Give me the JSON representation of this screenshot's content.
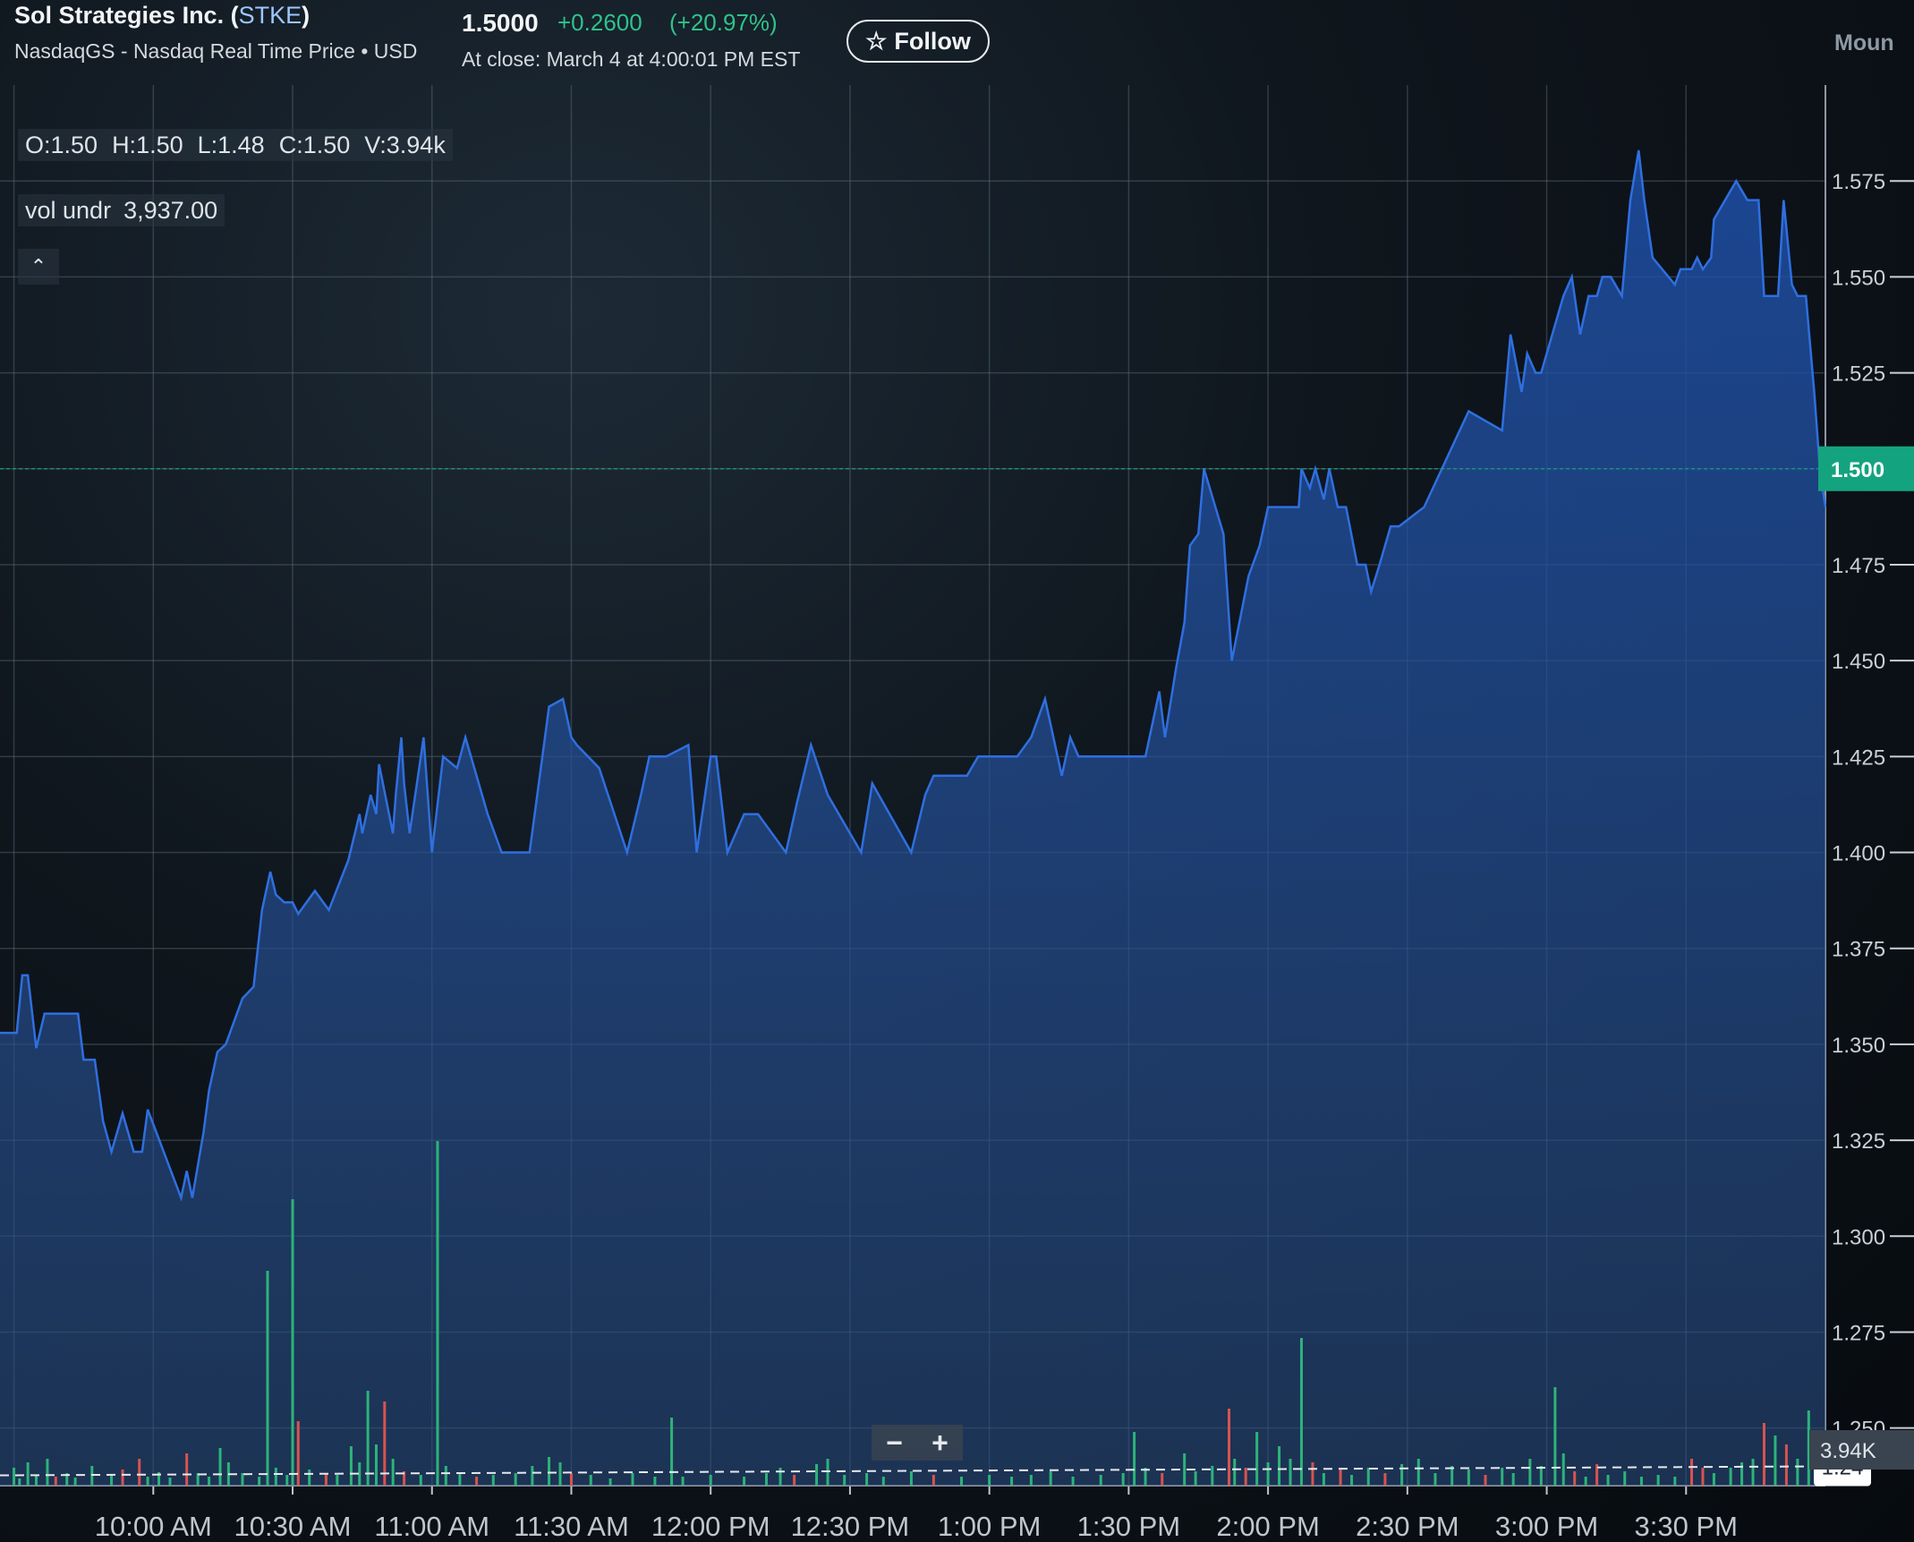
{
  "header": {
    "company_name": "Sol Strategies Inc. (",
    "ticker": "STKE",
    "company_close": ")",
    "exchange": "NasdaqGS - Nasdaq Real Time Price • USD",
    "price": "1.5000",
    "change": "+0.2600",
    "change_pct": "(+20.97%)",
    "close_time": "At close: March 4 at 4:00:01 PM EST",
    "follow_label": "Follow",
    "more_label": "Moun"
  },
  "ohlc": {
    "o": "O:1.50",
    "h": "H:1.50",
    "l": "L:1.48",
    "c": "C:1.50",
    "v": "V:3.94k"
  },
  "volume_info": {
    "label": "vol undr",
    "value": "3,937.00"
  },
  "zoom": {
    "minus": "−",
    "plus": "+"
  },
  "colors": {
    "line": "#2f6fe0",
    "up": "#2db37a",
    "down": "#d9534f",
    "current": "#14a37f"
  },
  "chart_data": {
    "type": "area",
    "title": "",
    "xlabel": "",
    "ylabel": "",
    "ylim": [
      1.235,
      1.6
    ],
    "y_ticks": [
      "1.575",
      "1.550",
      "1.525",
      "1.500",
      "1.475",
      "1.450",
      "1.425",
      "1.400",
      "1.375",
      "1.350",
      "1.325",
      "1.300",
      "1.275",
      "1.250"
    ],
    "x_ticks": [
      {
        "t": 10.0,
        "label": "10:00 AM"
      },
      {
        "t": 10.5,
        "label": "10:30 AM"
      },
      {
        "t": 11.0,
        "label": "11:00 AM"
      },
      {
        "t": 11.5,
        "label": "11:30 AM"
      },
      {
        "t": 12.0,
        "label": "12:00 PM"
      },
      {
        "t": 12.5,
        "label": "12:30 PM"
      },
      {
        "t": 13.0,
        "label": "1:00 PM"
      },
      {
        "t": 13.5,
        "label": "1:30 PM"
      },
      {
        "t": 14.0,
        "label": "2:00 PM"
      },
      {
        "t": 14.5,
        "label": "2:30 PM"
      },
      {
        "t": 15.0,
        "label": "3:00 PM"
      },
      {
        "t": 15.5,
        "label": "3:30 PM"
      }
    ],
    "x_range": [
      9.45,
      16.0
    ],
    "current_price": {
      "value": 1.5,
      "label": "1.500"
    },
    "prev_close": {
      "value": 1.24,
      "label": "1.24"
    },
    "volume_label": "3.94K",
    "grid": true,
    "price_series": {
      "x": [
        9.45,
        9.51,
        9.53,
        9.55,
        9.58,
        9.61,
        9.73,
        9.75,
        9.79,
        9.82,
        9.85,
        9.89,
        9.93,
        9.96,
        9.98,
        10.1,
        10.12,
        10.14,
        10.18,
        10.2,
        10.23,
        10.26,
        10.32,
        10.36,
        10.39,
        10.42,
        10.44,
        10.47,
        10.5,
        10.52,
        10.58,
        10.63,
        10.7,
        10.74,
        10.75,
        10.78,
        10.8,
        10.81,
        10.86,
        10.87,
        10.89,
        10.9,
        10.92,
        10.93,
        10.95,
        10.97,
        11.0,
        11.04,
        11.09,
        11.12,
        11.2,
        11.25,
        11.3,
        11.35,
        11.42,
        11.47,
        11.5,
        11.52,
        11.6,
        11.7,
        11.75,
        11.78,
        11.84,
        11.92,
        11.95,
        12.0,
        12.02,
        12.06,
        12.12,
        12.17,
        12.27,
        12.31,
        12.36,
        12.42,
        12.46,
        12.54,
        12.58,
        12.72,
        12.77,
        12.8,
        12.88,
        12.92,
        12.96,
        13.0,
        13.01,
        13.1,
        13.15,
        13.2,
        13.26,
        13.29,
        13.32,
        13.36,
        13.43,
        13.52,
        13.56,
        13.61,
        13.63,
        13.67,
        13.7,
        13.72,
        13.75,
        13.77,
        13.84,
        13.87,
        13.93,
        13.97,
        14.0,
        14.06,
        14.11,
        14.12,
        14.15,
        14.17,
        14.2,
        14.22,
        14.25,
        14.28,
        14.32,
        14.35,
        14.37,
        14.4,
        14.44,
        14.47,
        14.56,
        14.72,
        14.84,
        14.87,
        14.91,
        14.93,
        14.96,
        14.98,
        15.06,
        15.09,
        15.12,
        15.15,
        15.18,
        15.2,
        15.23,
        15.27,
        15.3,
        15.33,
        15.35,
        15.38,
        15.46,
        15.48,
        15.52,
        15.54,
        15.56,
        15.59,
        15.6,
        15.68,
        15.72,
        15.76,
        15.78,
        15.8,
        15.83,
        15.85,
        15.88,
        15.9,
        15.93,
        15.96,
        15.98,
        16.0
      ],
      "y": [
        1.353,
        1.353,
        1.368,
        1.368,
        1.349,
        1.358,
        1.358,
        1.346,
        1.346,
        1.33,
        1.322,
        1.332,
        1.322,
        1.322,
        1.333,
        1.31,
        1.317,
        1.31,
        1.327,
        1.338,
        1.348,
        1.35,
        1.362,
        1.365,
        1.385,
        1.395,
        1.389,
        1.387,
        1.387,
        1.384,
        1.39,
        1.385,
        1.398,
        1.41,
        1.405,
        1.415,
        1.41,
        1.423,
        1.405,
        1.415,
        1.43,
        1.418,
        1.405,
        1.41,
        1.42,
        1.43,
        1.4,
        1.425,
        1.422,
        1.43,
        1.41,
        1.4,
        1.4,
        1.4,
        1.438,
        1.44,
        1.43,
        1.428,
        1.422,
        1.4,
        1.415,
        1.425,
        1.425,
        1.428,
        1.4,
        1.425,
        1.425,
        1.4,
        1.41,
        1.41,
        1.4,
        1.413,
        1.428,
        1.415,
        1.41,
        1.4,
        1.418,
        1.4,
        1.415,
        1.42,
        1.42,
        1.42,
        1.425,
        1.425,
        1.425,
        1.425,
        1.43,
        1.44,
        1.42,
        1.43,
        1.425,
        1.425,
        1.425,
        1.425,
        1.425,
        1.442,
        1.43,
        1.448,
        1.46,
        1.48,
        1.483,
        1.5,
        1.483,
        1.45,
        1.472,
        1.48,
        1.49,
        1.49,
        1.49,
        1.5,
        1.495,
        1.5,
        1.492,
        1.5,
        1.49,
        1.49,
        1.475,
        1.475,
        1.468,
        1.475,
        1.485,
        1.485,
        1.49,
        1.515,
        1.51,
        1.535,
        1.52,
        1.53,
        1.525,
        1.525,
        1.545,
        1.55,
        1.535,
        1.545,
        1.545,
        1.55,
        1.55,
        1.545,
        1.57,
        1.583,
        1.57,
        1.555,
        1.548,
        1.552,
        1.552,
        1.555,
        1.552,
        1.555,
        1.565,
        1.575,
        1.57,
        1.57,
        1.545,
        1.545,
        1.545,
        1.57,
        1.548,
        1.545,
        1.545,
        1.52,
        1.5,
        1.49,
        1.49,
        1.5
      ]
    },
    "volume_bars": [
      {
        "t": 9.5,
        "h": 20,
        "d": "up"
      },
      {
        "t": 9.52,
        "h": 8,
        "d": "up"
      },
      {
        "t": 9.55,
        "h": 26,
        "d": "up"
      },
      {
        "t": 9.58,
        "h": 12,
        "d": "up"
      },
      {
        "t": 9.62,
        "h": 30,
        "d": "up"
      },
      {
        "t": 9.65,
        "h": 10,
        "d": "down"
      },
      {
        "t": 9.69,
        "h": 14,
        "d": "up"
      },
      {
        "t": 9.72,
        "h": 9,
        "d": "up"
      },
      {
        "t": 9.78,
        "h": 22,
        "d": "up"
      },
      {
        "t": 9.85,
        "h": 12,
        "d": "up"
      },
      {
        "t": 9.89,
        "h": 18,
        "d": "down"
      },
      {
        "t": 9.95,
        "h": 30,
        "d": "down"
      },
      {
        "t": 9.98,
        "h": 10,
        "d": "up"
      },
      {
        "t": 10.02,
        "h": 15,
        "d": "up"
      },
      {
        "t": 10.06,
        "h": 9,
        "d": "up"
      },
      {
        "t": 10.12,
        "h": 36,
        "d": "down"
      },
      {
        "t": 10.16,
        "h": 14,
        "d": "up"
      },
      {
        "t": 10.2,
        "h": 10,
        "d": "up"
      },
      {
        "t": 10.24,
        "h": 42,
        "d": "up"
      },
      {
        "t": 10.27,
        "h": 26,
        "d": "up"
      },
      {
        "t": 10.32,
        "h": 14,
        "d": "up"
      },
      {
        "t": 10.38,
        "h": 10,
        "d": "up"
      },
      {
        "t": 10.41,
        "h": 240,
        "d": "up"
      },
      {
        "t": 10.44,
        "h": 20,
        "d": "up"
      },
      {
        "t": 10.48,
        "h": 12,
        "d": "up"
      },
      {
        "t": 10.5,
        "h": 320,
        "d": "up"
      },
      {
        "t": 10.52,
        "h": 72,
        "d": "down"
      },
      {
        "t": 10.56,
        "h": 18,
        "d": "up"
      },
      {
        "t": 10.62,
        "h": 14,
        "d": "down"
      },
      {
        "t": 10.66,
        "h": 12,
        "d": "up"
      },
      {
        "t": 10.71,
        "h": 44,
        "d": "up"
      },
      {
        "t": 10.74,
        "h": 26,
        "d": "up"
      },
      {
        "t": 10.77,
        "h": 106,
        "d": "up"
      },
      {
        "t": 10.8,
        "h": 46,
        "d": "up"
      },
      {
        "t": 10.83,
        "h": 94,
        "d": "down"
      },
      {
        "t": 10.86,
        "h": 30,
        "d": "up"
      },
      {
        "t": 10.9,
        "h": 16,
        "d": "down"
      },
      {
        "t": 10.96,
        "h": 12,
        "d": "up"
      },
      {
        "t": 11.02,
        "h": 385,
        "d": "up"
      },
      {
        "t": 11.05,
        "h": 22,
        "d": "up"
      },
      {
        "t": 11.1,
        "h": 14,
        "d": "up"
      },
      {
        "t": 11.16,
        "h": 10,
        "d": "down"
      },
      {
        "t": 11.22,
        "h": 12,
        "d": "up"
      },
      {
        "t": 11.3,
        "h": 14,
        "d": "up"
      },
      {
        "t": 11.36,
        "h": 22,
        "d": "up"
      },
      {
        "t": 11.42,
        "h": 32,
        "d": "up"
      },
      {
        "t": 11.46,
        "h": 26,
        "d": "up"
      },
      {
        "t": 11.5,
        "h": 14,
        "d": "down"
      },
      {
        "t": 11.57,
        "h": 12,
        "d": "up"
      },
      {
        "t": 11.64,
        "h": 8,
        "d": "up"
      },
      {
        "t": 11.72,
        "h": 14,
        "d": "up"
      },
      {
        "t": 11.8,
        "h": 10,
        "d": "up"
      },
      {
        "t": 11.86,
        "h": 76,
        "d": "up"
      },
      {
        "t": 11.9,
        "h": 10,
        "d": "up"
      },
      {
        "t": 12.0,
        "h": 12,
        "d": "up"
      },
      {
        "t": 12.12,
        "h": 10,
        "d": "up"
      },
      {
        "t": 12.2,
        "h": 14,
        "d": "up"
      },
      {
        "t": 12.25,
        "h": 20,
        "d": "up"
      },
      {
        "t": 12.3,
        "h": 12,
        "d": "down"
      },
      {
        "t": 12.38,
        "h": 24,
        "d": "up"
      },
      {
        "t": 12.42,
        "h": 30,
        "d": "up"
      },
      {
        "t": 12.48,
        "h": 12,
        "d": "up"
      },
      {
        "t": 12.56,
        "h": 14,
        "d": "up"
      },
      {
        "t": 12.62,
        "h": 10,
        "d": "up"
      },
      {
        "t": 12.72,
        "h": 16,
        "d": "up"
      },
      {
        "t": 12.8,
        "h": 12,
        "d": "down"
      },
      {
        "t": 12.9,
        "h": 10,
        "d": "up"
      },
      {
        "t": 13.0,
        "h": 12,
        "d": "up"
      },
      {
        "t": 13.08,
        "h": 10,
        "d": "up"
      },
      {
        "t": 13.15,
        "h": 12,
        "d": "up"
      },
      {
        "t": 13.22,
        "h": 16,
        "d": "up"
      },
      {
        "t": 13.3,
        "h": 10,
        "d": "up"
      },
      {
        "t": 13.4,
        "h": 12,
        "d": "up"
      },
      {
        "t": 13.48,
        "h": 14,
        "d": "up"
      },
      {
        "t": 13.52,
        "h": 60,
        "d": "up"
      },
      {
        "t": 13.56,
        "h": 20,
        "d": "up"
      },
      {
        "t": 13.62,
        "h": 14,
        "d": "down"
      },
      {
        "t": 13.7,
        "h": 36,
        "d": "up"
      },
      {
        "t": 13.74,
        "h": 16,
        "d": "up"
      },
      {
        "t": 13.8,
        "h": 22,
        "d": "up"
      },
      {
        "t": 13.86,
        "h": 86,
        "d": "down"
      },
      {
        "t": 13.88,
        "h": 30,
        "d": "up"
      },
      {
        "t": 13.92,
        "h": 20,
        "d": "down"
      },
      {
        "t": 13.96,
        "h": 60,
        "d": "up"
      },
      {
        "t": 14.0,
        "h": 26,
        "d": "up"
      },
      {
        "t": 14.04,
        "h": 44,
        "d": "up"
      },
      {
        "t": 14.08,
        "h": 30,
        "d": "up"
      },
      {
        "t": 14.12,
        "h": 165,
        "d": "up"
      },
      {
        "t": 14.16,
        "h": 26,
        "d": "down"
      },
      {
        "t": 14.2,
        "h": 14,
        "d": "up"
      },
      {
        "t": 14.26,
        "h": 18,
        "d": "down"
      },
      {
        "t": 14.3,
        "h": 12,
        "d": "up"
      },
      {
        "t": 14.36,
        "h": 20,
        "d": "up"
      },
      {
        "t": 14.42,
        "h": 14,
        "d": "down"
      },
      {
        "t": 14.48,
        "h": 24,
        "d": "up"
      },
      {
        "t": 14.54,
        "h": 30,
        "d": "up"
      },
      {
        "t": 14.6,
        "h": 14,
        "d": "up"
      },
      {
        "t": 14.66,
        "h": 22,
        "d": "up"
      },
      {
        "t": 14.72,
        "h": 18,
        "d": "up"
      },
      {
        "t": 14.78,
        "h": 12,
        "d": "down"
      },
      {
        "t": 14.84,
        "h": 20,
        "d": "up"
      },
      {
        "t": 14.88,
        "h": 14,
        "d": "up"
      },
      {
        "t": 14.94,
        "h": 30,
        "d": "up"
      },
      {
        "t": 14.98,
        "h": 22,
        "d": "up"
      },
      {
        "t": 15.03,
        "h": 110,
        "d": "up"
      },
      {
        "t": 15.06,
        "h": 36,
        "d": "up"
      },
      {
        "t": 15.1,
        "h": 16,
        "d": "down"
      },
      {
        "t": 15.14,
        "h": 10,
        "d": "up"
      },
      {
        "t": 15.18,
        "h": 24,
        "d": "down"
      },
      {
        "t": 15.22,
        "h": 12,
        "d": "up"
      },
      {
        "t": 15.28,
        "h": 16,
        "d": "up"
      },
      {
        "t": 15.34,
        "h": 10,
        "d": "up"
      },
      {
        "t": 15.4,
        "h": 12,
        "d": "up"
      },
      {
        "t": 15.46,
        "h": 10,
        "d": "up"
      },
      {
        "t": 15.52,
        "h": 30,
        "d": "down"
      },
      {
        "t": 15.56,
        "h": 20,
        "d": "down"
      },
      {
        "t": 15.6,
        "h": 14,
        "d": "up"
      },
      {
        "t": 15.66,
        "h": 20,
        "d": "up"
      },
      {
        "t": 15.7,
        "h": 26,
        "d": "up"
      },
      {
        "t": 15.74,
        "h": 30,
        "d": "up"
      },
      {
        "t": 15.78,
        "h": 70,
        "d": "down"
      },
      {
        "t": 15.82,
        "h": 56,
        "d": "up"
      },
      {
        "t": 15.86,
        "h": 46,
        "d": "down"
      },
      {
        "t": 15.9,
        "h": 30,
        "d": "up"
      },
      {
        "t": 15.94,
        "h": 84,
        "d": "up"
      },
      {
        "t": 15.97,
        "h": 42,
        "d": "up"
      }
    ]
  }
}
